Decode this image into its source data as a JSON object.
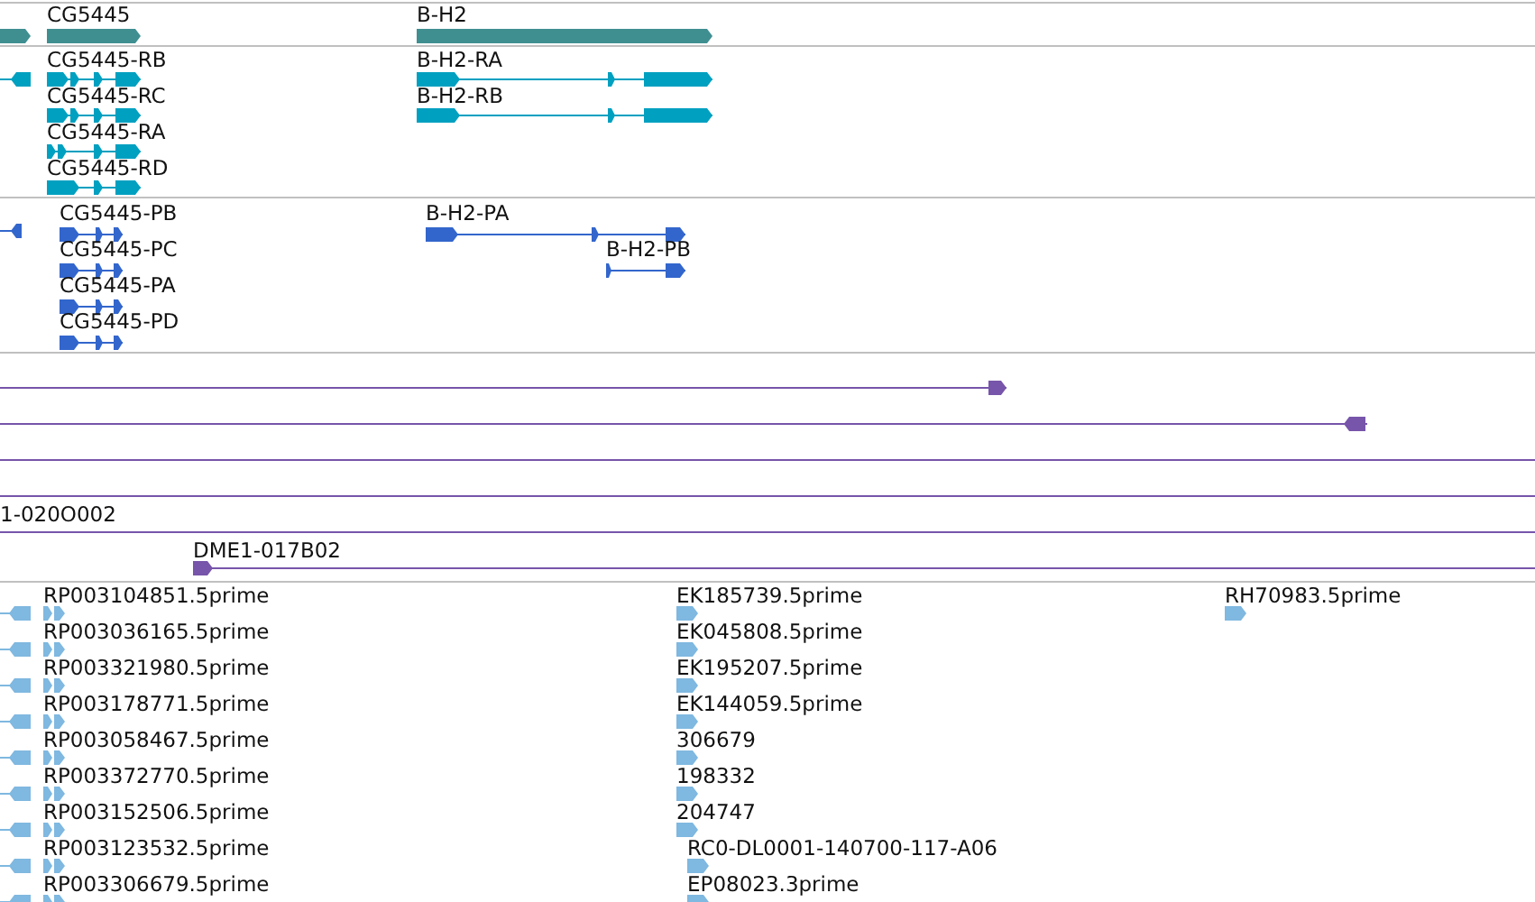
{
  "tracks": [
    {
      "kind": "gene",
      "features": [
        {
          "label": "CG5445"
        },
        {
          "label": "B-H2"
        }
      ]
    },
    {
      "kind": "transcript",
      "features": [
        {
          "label": "CG5445-RB"
        },
        {
          "label": "CG5445-RC"
        },
        {
          "label": "CG5445-RA"
        },
        {
          "label": "CG5445-RD"
        },
        {
          "label": "B-H2-RA"
        },
        {
          "label": "B-H2-RB"
        }
      ]
    },
    {
      "kind": "protein",
      "features": [
        {
          "label": "CG5445-PB"
        },
        {
          "label": "CG5445-PC"
        },
        {
          "label": "CG5445-PA"
        },
        {
          "label": "CG5445-PD"
        },
        {
          "label": "B-H2-PA"
        },
        {
          "label": "B-H2-PB"
        }
      ]
    },
    {
      "kind": "clone",
      "features": [
        {
          "label": "1-020O002"
        },
        {
          "label": "DME1-017B02"
        }
      ]
    },
    {
      "kind": "est",
      "columns": [
        {
          "features": [
            {
              "kind": "stub"
            },
            {
              "kind": "stub"
            },
            {
              "kind": "stub"
            },
            {
              "kind": "stub"
            },
            {
              "kind": "stub"
            },
            {
              "kind": "stub"
            },
            {
              "kind": "stub"
            },
            {
              "kind": "stub"
            },
            {
              "kind": "stub"
            }
          ]
        },
        {
          "features": [
            {
              "kind": "feature",
              "label": "RP003104851.5prime"
            },
            {
              "kind": "feature",
              "label": "RP003036165.5prime"
            },
            {
              "kind": "feature",
              "label": "RP003321980.5prime"
            },
            {
              "kind": "feature",
              "label": "RP003178771.5prime"
            },
            {
              "kind": "feature",
              "label": "RP003058467.5prime"
            },
            {
              "kind": "feature",
              "label": "RP003372770.5prime"
            },
            {
              "kind": "feature",
              "label": "RP003152506.5prime"
            },
            {
              "kind": "feature",
              "label": "RP003123532.5prime"
            },
            {
              "kind": "feature",
              "label": "RP003306679.5prime"
            }
          ]
        },
        {
          "features": [
            {
              "kind": "feature",
              "label": "EK185739.5prime"
            },
            {
              "kind": "feature",
              "label": "EK045808.5prime"
            },
            {
              "kind": "feature",
              "label": "EK195207.5prime"
            },
            {
              "kind": "feature",
              "label": "EK144059.5prime"
            },
            {
              "kind": "feature",
              "label": "306679"
            },
            {
              "kind": "feature",
              "label": "198332"
            },
            {
              "kind": "feature",
              "label": "204747"
            },
            {
              "kind": "feature",
              "label": "RC0-DL0001-140700-117-A06"
            },
            {
              "kind": "feature",
              "label": "EP08023.3prime"
            }
          ]
        },
        {
          "features": [
            {
              "kind": "feature",
              "label": "RH70983.5prime"
            }
          ]
        }
      ]
    }
  ]
}
